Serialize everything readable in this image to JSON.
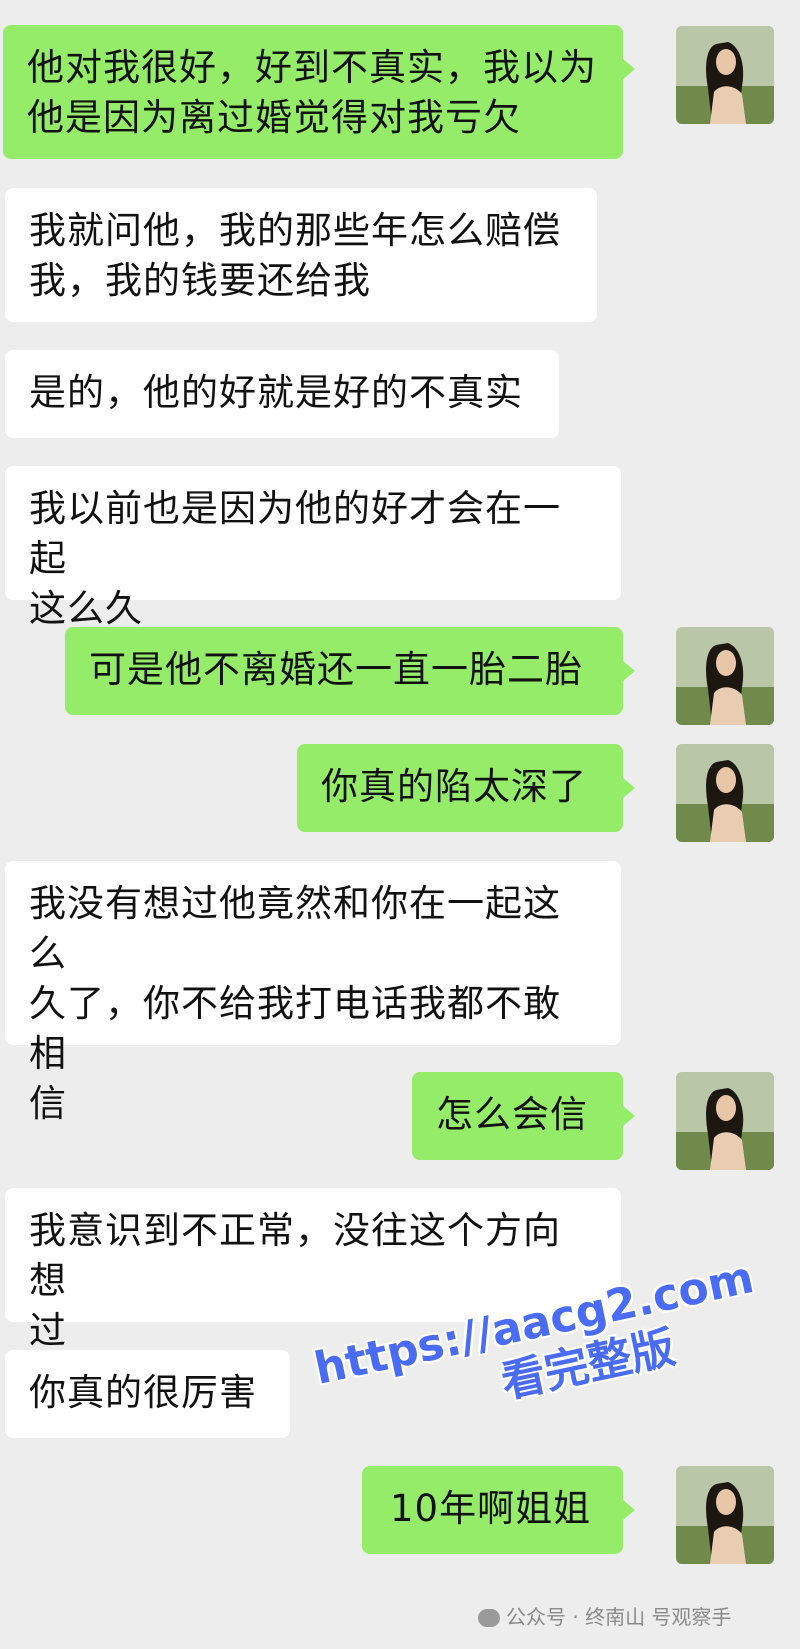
{
  "messages": [
    {
      "side": "out",
      "text": "他对我很好，好到不真实，我以为\n他是因为离过婚觉得对我亏欠"
    },
    {
      "side": "in",
      "text": "我就问他，我的那些年怎么赔偿\n我，我的钱要还给我"
    },
    {
      "side": "in",
      "text": "是的，他的好就是好的不真实"
    },
    {
      "side": "in",
      "text": "我以前也是因为他的好才会在一起\n这么久"
    },
    {
      "side": "out",
      "text": "可是他不离婚还一直一胎二胎"
    },
    {
      "side": "out",
      "text": "你真的陷太深了"
    },
    {
      "side": "in",
      "text": "我没有想过他竟然和你在一起这么\n久了，你不给我打电话我都不敢相\n信"
    },
    {
      "side": "out",
      "text": "怎么会信"
    },
    {
      "side": "in",
      "text": "我意识到不正常，没往这个方向想\n过"
    },
    {
      "side": "in",
      "text": "你真的很厉害"
    },
    {
      "side": "out",
      "text": "10年啊姐姐"
    }
  ],
  "watermark": {
    "url": "https://aacg2.com",
    "subtitle": "看完整版"
  },
  "footer": {
    "credit": "公众号 · 终南山 号观察手"
  },
  "colors": {
    "background": "#ededed",
    "incoming_bubble": "#ffffff",
    "outgoing_bubble": "#95ec69",
    "watermark": "#4a6cf5"
  }
}
